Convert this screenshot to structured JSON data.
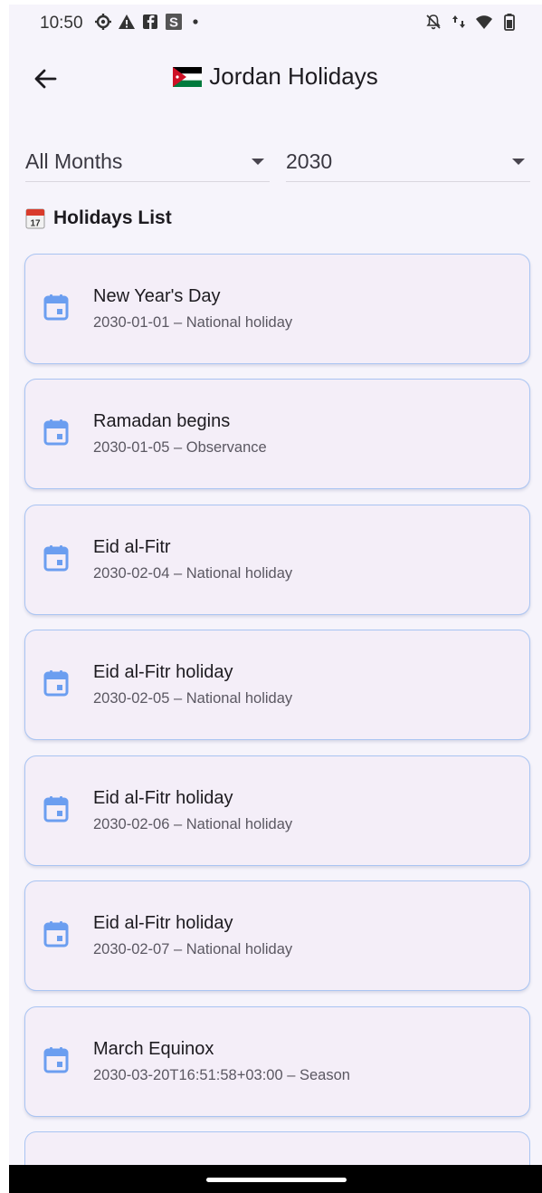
{
  "status_bar": {
    "time": "10:50",
    "left_icons": [
      "settings-gear-icon",
      "warning-icon",
      "facebook-icon",
      "s-app-icon",
      "dot-icon"
    ],
    "right_icons": [
      "bell-off-icon",
      "data-arrows-icon",
      "wifi-icon",
      "battery-icon"
    ]
  },
  "app_bar": {
    "title": "Jordan Holidays",
    "flag": "jordan-flag-icon"
  },
  "filters": {
    "month": "All Months",
    "year": "2030"
  },
  "section": {
    "label": "Holidays List"
  },
  "holidays": [
    {
      "name": "New Year's Day",
      "detail": "2030-01-01 – National holiday"
    },
    {
      "name": "Ramadan begins",
      "detail": "2030-01-05 – Observance"
    },
    {
      "name": "Eid al-Fitr",
      "detail": "2030-02-04 – National holiday"
    },
    {
      "name": "Eid al-Fitr holiday",
      "detail": "2030-02-05 – National holiday"
    },
    {
      "name": "Eid al-Fitr holiday",
      "detail": "2030-02-06 – National holiday"
    },
    {
      "name": "Eid al-Fitr holiday",
      "detail": "2030-02-07 – National holiday"
    },
    {
      "name": "March Equinox",
      "detail": "2030-03-20T16:51:58+03:00 – Season"
    }
  ],
  "colors": {
    "background": "#f6f4fb",
    "card": "#f4eef8",
    "card_border": "#a9c4f2",
    "calendar_icon": "#6b9ef0"
  }
}
